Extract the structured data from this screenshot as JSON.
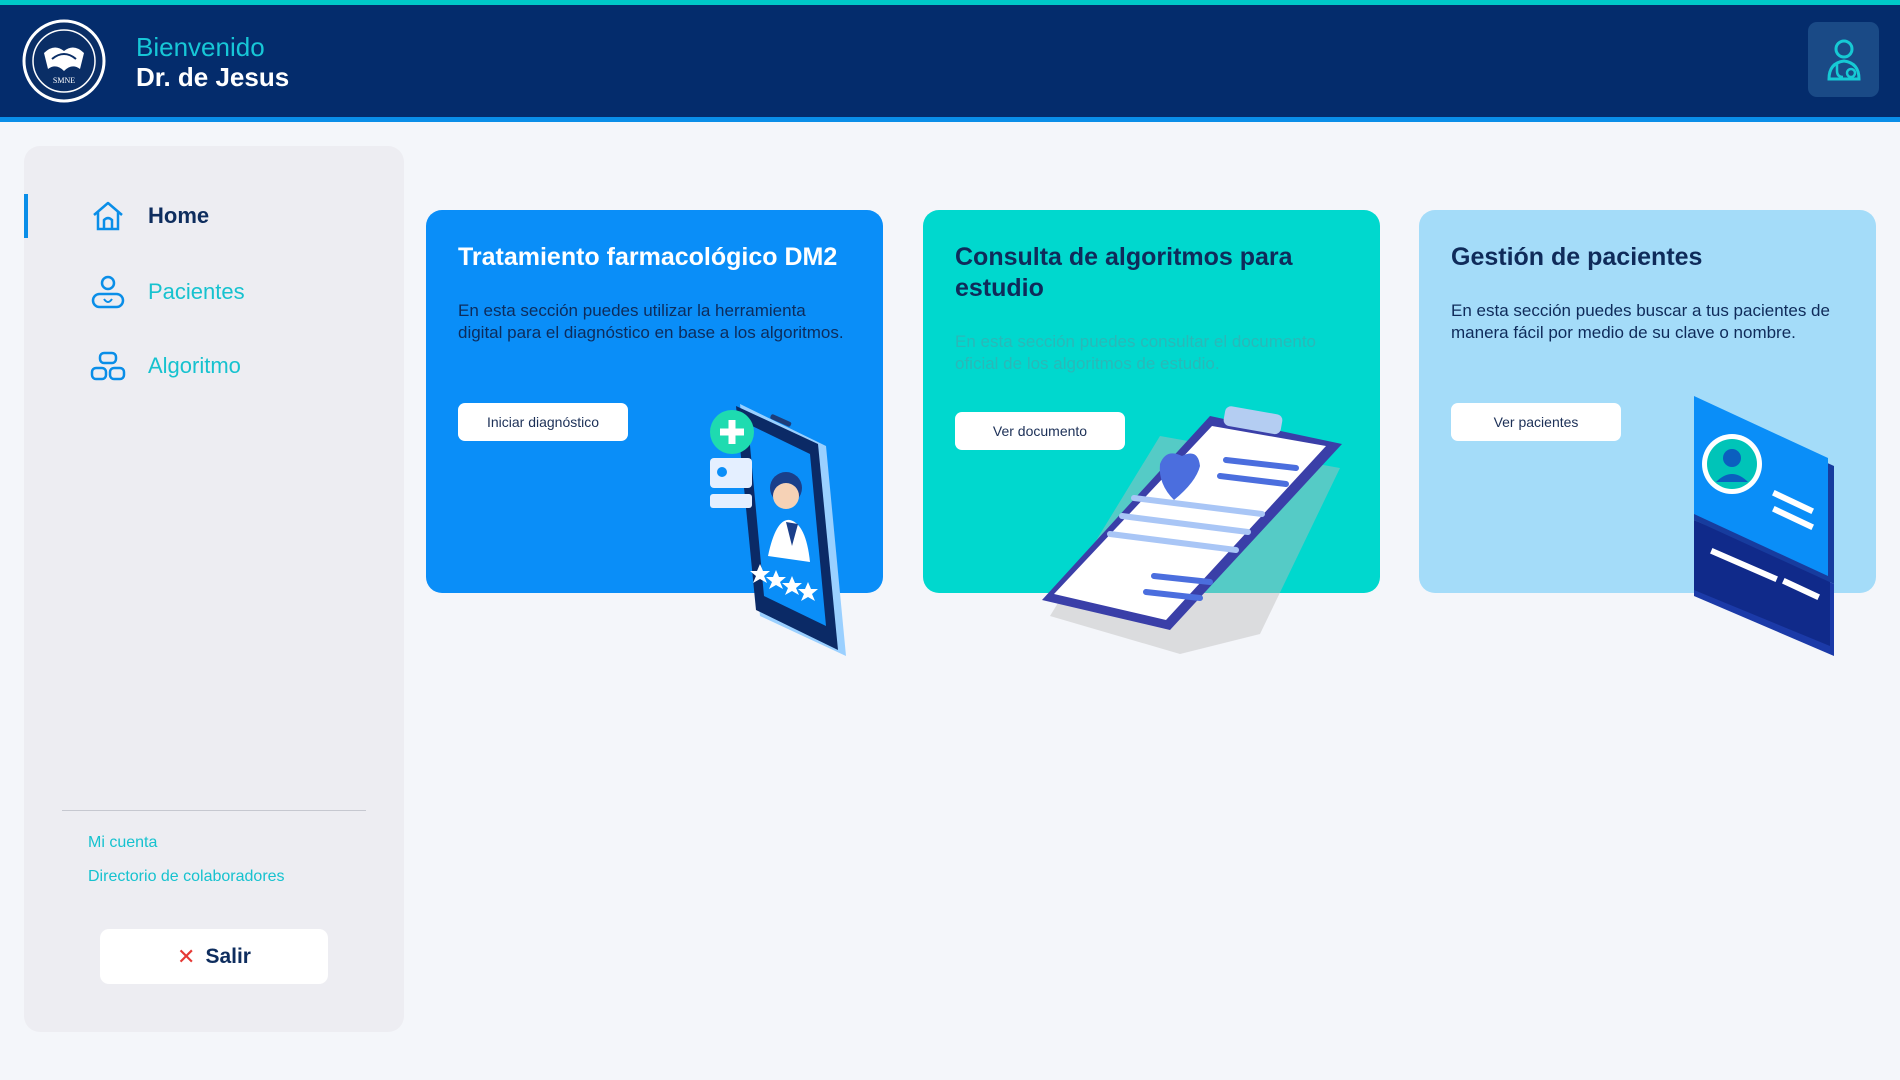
{
  "header": {
    "greeting": "Bienvenido",
    "user_name": "Dr. de Jesus",
    "logo_text": "SMNE",
    "profile_icon": "doctor-profile-icon"
  },
  "colors": {
    "header_bg": "#042c6c",
    "accent_teal": "#00c9c8",
    "accent_blue": "#0a8ee8",
    "sidebar_bg": "#ededf2",
    "page_bg": "#f4f6fa"
  },
  "sidebar": {
    "items": [
      {
        "label": "Home",
        "icon": "home-icon",
        "active": true
      },
      {
        "label": "Pacientes",
        "icon": "patient-icon",
        "active": false
      },
      {
        "label": "Algoritmo",
        "icon": "algorithm-icon",
        "active": false
      }
    ],
    "links": [
      {
        "label": "Mi cuenta"
      },
      {
        "label": "Directorio de colaboradores"
      }
    ],
    "logout": {
      "label": "Salir",
      "icon": "close-icon"
    }
  },
  "cards": [
    {
      "title": "Tratamiento farmacológico DM2",
      "description": "En esta sección puedes utilizar la herramienta digital para el diagnóstico en base a los algoritmos.",
      "button": "Iniciar diagnóstico",
      "illustration": "phone-doctor-illustration",
      "color": "#0a8ef8"
    },
    {
      "title": "Consulta de algoritmos para estudio",
      "description": "En esta sección puedes consultar el documento oficial de los algoritmos de estudio.",
      "button": "Ver documento",
      "illustration": "clipboard-illustration",
      "color": "#00d8ce"
    },
    {
      "title": "Gestión de pacientes",
      "description": "En esta sección puedes buscar a tus pacientes de manera fácil por medio de su clave o nombre.",
      "button": "Ver pacientes",
      "illustration": "id-card-illustration",
      "color": "#a4dcf9"
    }
  ]
}
